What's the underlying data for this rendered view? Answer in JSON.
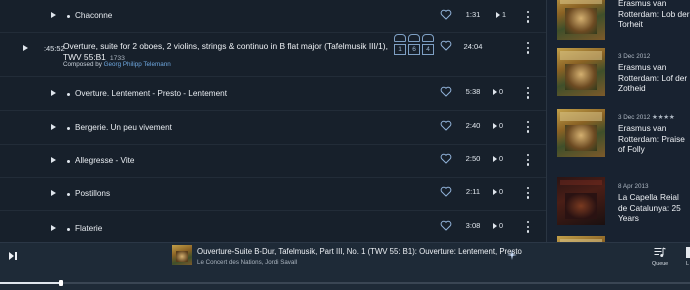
{
  "tracks_top": {
    "title": "Chaconne",
    "duration": "1:31",
    "plays": "1"
  },
  "work": {
    "timecode": ":45:52",
    "title": "Overture, suite for 2 oboes, 2 violins, strings & continuo in B flat major (Tafelmusik III/1), TWV 55:B1",
    "year": "1733",
    "composed_by_label": "Composed by",
    "composer": "Georg Philipp Telemann",
    "duration": "24:04",
    "badges_top": [
      "",
      "",
      ""
    ],
    "badges_bottom": [
      "1",
      "6",
      "4"
    ]
  },
  "movements": [
    {
      "title": "Overture. Lentement - Presto - Lentement",
      "duration": "5:38",
      "plays": "0"
    },
    {
      "title": "Bergerie. Un peu vivement",
      "duration": "2:40",
      "plays": "0"
    },
    {
      "title": "Allegresse - Vite",
      "duration": "2:50",
      "plays": "0"
    },
    {
      "title": "Postillons",
      "duration": "2:11",
      "plays": "0"
    },
    {
      "title": "Flaterie",
      "duration": "3:08",
      "plays": "0"
    }
  ],
  "sidebar": {
    "albums": [
      {
        "date": "",
        "title": "Erasmus van Rotterdam: Lob der Torheit"
      },
      {
        "date": "3 Dec 2012",
        "title": "Erasmus van Rotterdam: Lof der Zotheid"
      },
      {
        "date": "3 Dec 2012 ★★★★",
        "title": "Erasmus van Rotterdam: Praise of Folly"
      },
      {
        "date": "8 Apr 2013",
        "title": "La Capella Reial de Catalunya: 25 Years"
      }
    ]
  },
  "player": {
    "now_playing_title": "Ouverture-Suite B-Dur, Tafelmusik, Part III, No. 1 (TWV 55: B1): Ouverture: Lentement, Presto",
    "now_playing_artist": "Le Concert des Nations, Jordi Savall",
    "queue_label": "Queue",
    "more_label": "L",
    "progress": 0.088
  },
  "colors": {
    "background": "#17202b",
    "player_bg": "#1e2a37",
    "heart": "#8fb0d6",
    "link": "#6fa8e0"
  }
}
